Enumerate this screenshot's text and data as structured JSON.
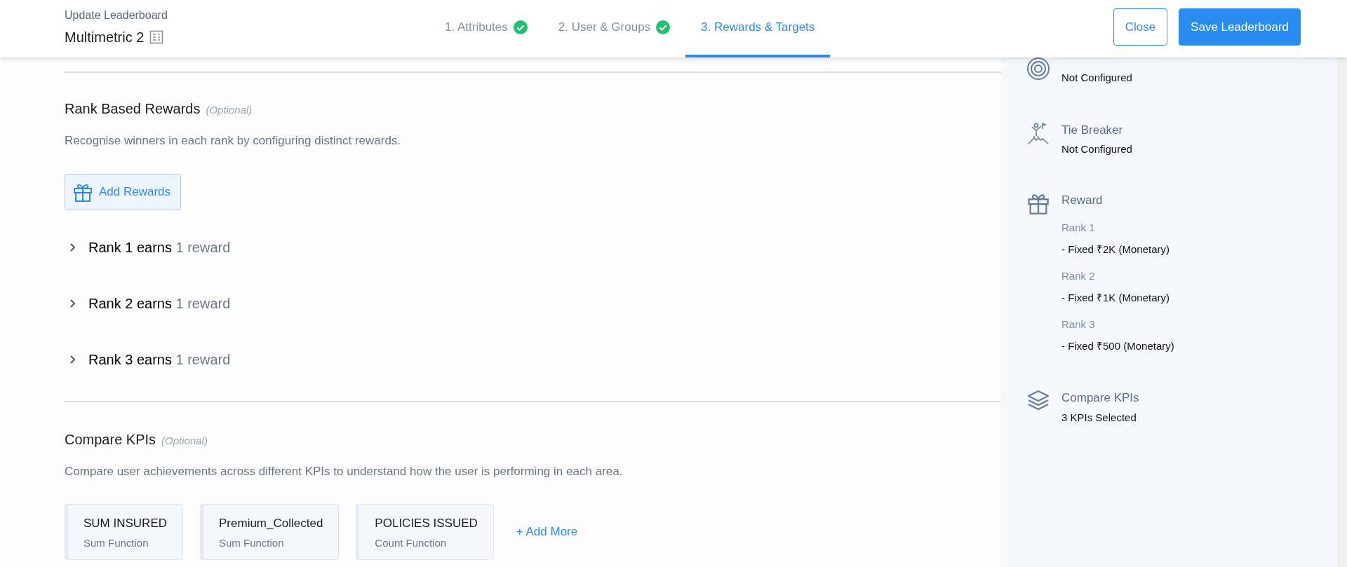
{
  "header": {
    "subtitle": "Update Leaderboard",
    "title": "Multimetric 2"
  },
  "steps": [
    {
      "label": "1. Attributes",
      "done": true,
      "selected": false
    },
    {
      "label": "2. User & Groups",
      "done": true,
      "selected": false
    },
    {
      "label": "3. Rewards & Targets",
      "done": false,
      "selected": true
    }
  ],
  "actions": [
    {
      "label": "Close",
      "kind": "outline"
    },
    {
      "label": "Save Leaderboard",
      "kind": "primary"
    }
  ],
  "rank_rewards": {
    "title": "Rank Based Rewards",
    "optional": "(Optional)",
    "description": "Recognise winners in each rank by configuring distinct rewards.",
    "add_button": "Add Rewards",
    "ranks": [
      {
        "label": "Rank 1 earns",
        "count": "1 reward",
        "expanded": false
      },
      {
        "label": "Rank 2 earns",
        "count": "1 reward",
        "expanded": false
      },
      {
        "label": "Rank 3 earns",
        "count": "1 reward",
        "expanded": false
      }
    ]
  },
  "compare_kpis": {
    "title": "Compare KPIs",
    "optional": "(Optional)",
    "description": "Compare user achievements across different KPIs to understand how the user is performing in each area.",
    "kpis": [
      {
        "name": "SUM INSURED",
        "function": "Sum Function"
      },
      {
        "name": "Premium_Collected",
        "function": "Sum Function"
      },
      {
        "name": "POLICIES ISSUED",
        "function": "Count Function"
      }
    ],
    "add_more": "+ Add More"
  },
  "summary": [
    {
      "kind": "target",
      "value": "Not Configured"
    },
    {
      "kind": "tie",
      "title": "Tie Breaker",
      "value": "Not Configured"
    },
    {
      "kind": "reward",
      "title": "Reward",
      "ranks": [
        {
          "rank": "Rank 1",
          "detail": "- Fixed ₹2K (Monetary)"
        },
        {
          "rank": "Rank 2",
          "detail": "- Fixed ₹1K (Monetary)"
        },
        {
          "rank": "Rank 3",
          "detail": "- Fixed ₹500 (Monetary)"
        }
      ]
    },
    {
      "kind": "kpis",
      "title": "Compare KPIs",
      "value": "3 KPIs Selected"
    }
  ]
}
